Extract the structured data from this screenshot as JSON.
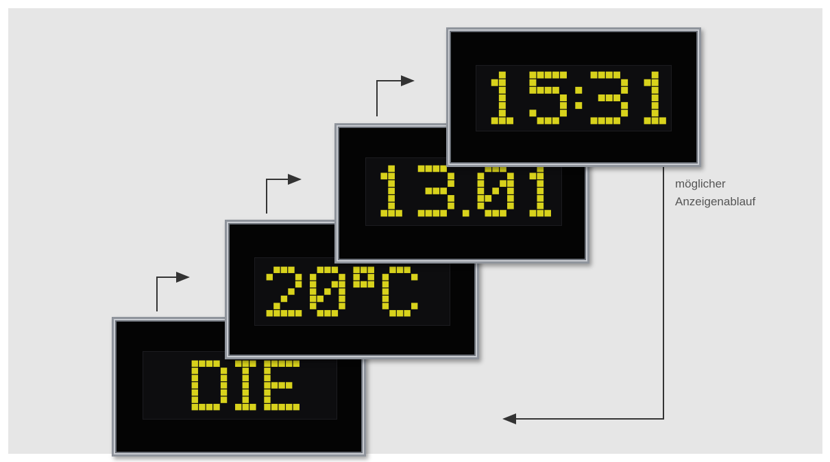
{
  "displays": [
    {
      "id": "date",
      "text": "13.01."
    },
    {
      "id": "temperature",
      "text": "20°C"
    },
    {
      "id": "word",
      "text": "DIE"
    },
    {
      "id": "time",
      "text": "15:31"
    }
  ],
  "caption": {
    "line1": "möglicher",
    "line2": "Anzeigenablauf"
  },
  "colors": {
    "background": "#e6e6e6",
    "led_on": "#d8d21c",
    "panel": "#040404",
    "frame": "#8f949c",
    "arrow": "#333333"
  }
}
